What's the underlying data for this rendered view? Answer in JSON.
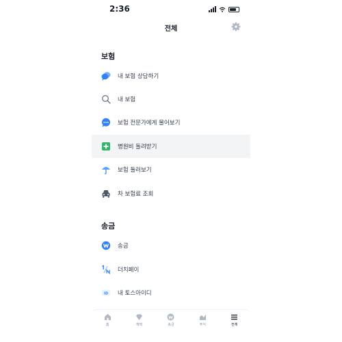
{
  "status_bar": {
    "time": "2:36"
  },
  "header": {
    "title": "전체"
  },
  "sections": [
    {
      "title": "보험",
      "items": [
        {
          "label": "내 보험 상담하기",
          "icon": "chat-bubbles-icon"
        },
        {
          "label": "내 보험",
          "icon": "search-icon"
        },
        {
          "label": "보험 전문가에게 물어보기",
          "icon": "speech-bubble-icon"
        },
        {
          "label": "병원비 돌려받기",
          "icon": "plus-square-icon"
        },
        {
          "label": "보험 둘러보기",
          "icon": "umbrella-icon"
        },
        {
          "label": "차 보험료 조회",
          "icon": "car-icon"
        }
      ]
    },
    {
      "title": "송금",
      "items": [
        {
          "label": "송금",
          "icon": "won-coin-icon"
        },
        {
          "label": "더치페이",
          "icon": "dutch-pay-icon"
        },
        {
          "label": "내 토스아이디",
          "icon": "id-badge-icon"
        }
      ]
    }
  ],
  "tabbar": [
    {
      "label": "홈",
      "icon": "home-icon"
    },
    {
      "label": "혜택",
      "icon": "gem-icon"
    },
    {
      "label": "송금",
      "icon": "won-icon"
    },
    {
      "label": "주식",
      "icon": "stock-chart-icon"
    },
    {
      "label": "전체",
      "icon": "menu-icon"
    }
  ],
  "colors": {
    "accent": "#3182f6",
    "text": "#191f28",
    "highlight": "#f2f4f6",
    "green": "#2fb66a"
  }
}
